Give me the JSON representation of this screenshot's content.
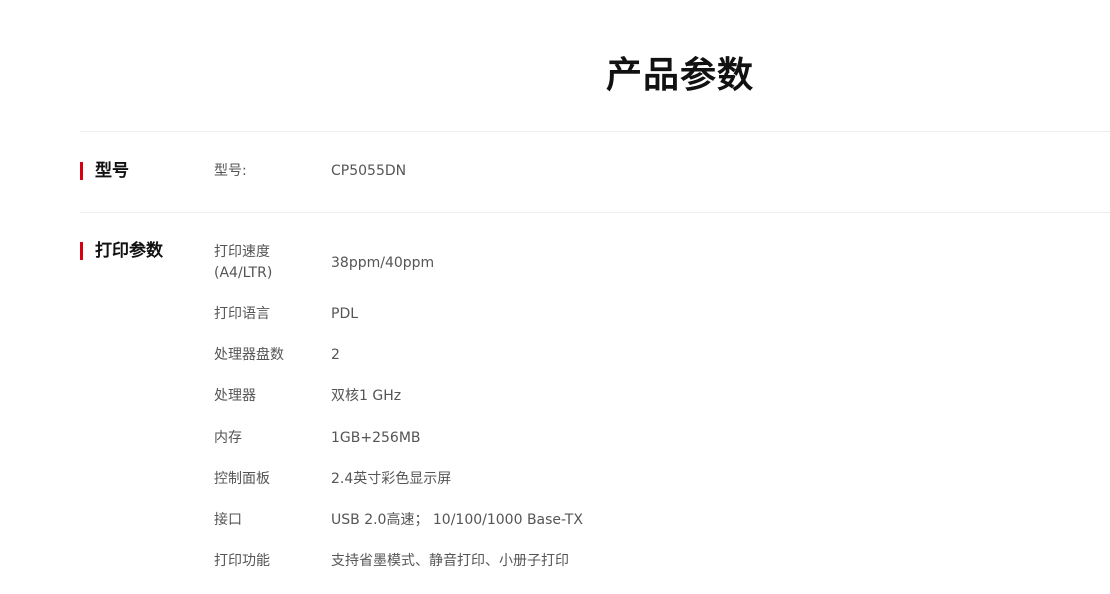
{
  "page_title": "产品参数",
  "sections": {
    "model": {
      "heading": "型号",
      "rows": [
        {
          "label": "型号:",
          "value": "CP5055DN"
        }
      ]
    },
    "print": {
      "heading": "打印参数",
      "rows": [
        {
          "label": "打印速度(A4/LTR)",
          "value": "38ppm/40ppm"
        },
        {
          "label": "打印语言",
          "value": "PDL"
        },
        {
          "label": "处理器盘数",
          "value": "2"
        },
        {
          "label": "处理器",
          "value": "双核1 GHz"
        },
        {
          "label": "内存",
          "value": "1GB+256MB"
        },
        {
          "label": "控制面板",
          "value": "2.4英寸彩色显示屏"
        },
        {
          "label": "接口",
          "value": "USB 2.0高速； 10/100/1000 Base-TX"
        },
        {
          "label": "打印功能",
          "value": "支持省墨模式、静音打印、小册子打印"
        }
      ]
    }
  },
  "colors": {
    "accent": "#d7000f",
    "divider": "#eeeeee",
    "text": "#555555",
    "heading": "#111111"
  }
}
